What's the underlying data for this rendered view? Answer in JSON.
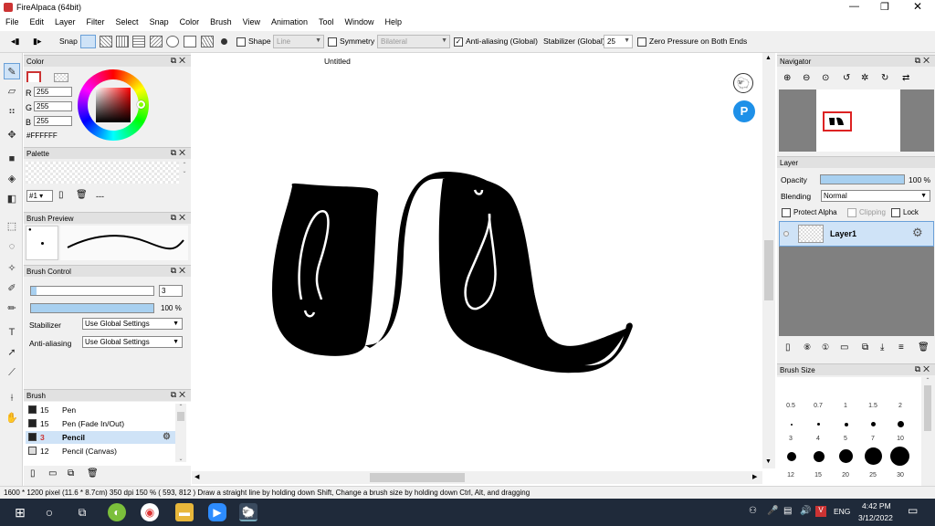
{
  "app": {
    "title": "FireAlpaca (64bit)"
  },
  "menu": [
    "File",
    "Edit",
    "Layer",
    "Filter",
    "Select",
    "Snap",
    "Color",
    "Brush",
    "View",
    "Animation",
    "Tool",
    "Window",
    "Help"
  ],
  "toolbar": {
    "snap_label": "Snap",
    "shape_label": "Shape",
    "shape_value": "Line",
    "symmetry_label": "Symmetry",
    "symmetry_value": "Bilateral",
    "antialias_label": "Anti-aliasing (Global)",
    "stabilizer_label": "Stabilizer (Global)",
    "stabilizer_value": "25",
    "zero_pressure_label": "Zero Pressure on Both Ends"
  },
  "color_panel": {
    "title": "Color",
    "r_label": "R",
    "r_value": "255",
    "g_label": "G",
    "g_value": "255",
    "b_label": "B",
    "b_value": "255",
    "hex": "#FFFFFF"
  },
  "palette_panel": {
    "title": "Palette",
    "selector": "#1",
    "dash": "---"
  },
  "brush_preview": {
    "title": "Brush Preview"
  },
  "brush_control": {
    "title": "Brush Control",
    "size_value": "3",
    "opacity_value": "100 %",
    "stabilizer_label": "Stabilizer",
    "stabilizer_value": "Use Global Settings",
    "antialias_label": "Anti-aliasing",
    "antialias_value": "Use Global Settings"
  },
  "brush_list": {
    "title": "Brush",
    "items": [
      {
        "size": "15",
        "name": "Pen"
      },
      {
        "size": "15",
        "name": "Pen (Fade In/Out)"
      },
      {
        "size": "3",
        "name": "Pencil"
      },
      {
        "size": "12",
        "name": "Pencil (Canvas)"
      }
    ]
  },
  "canvas": {
    "tab_title": "Untitled"
  },
  "navigator": {
    "title": "Navigator"
  },
  "layer_panel": {
    "title": "Layer",
    "opacity_label": "Opacity",
    "opacity_value": "100 %",
    "blending_label": "Blending",
    "blending_value": "Normal",
    "protect_alpha": "Protect Alpha",
    "clipping": "Clipping",
    "lock": "Lock",
    "layer_name": "Layer1"
  },
  "brush_size_panel": {
    "title": "Brush Size",
    "labels_row1": [
      "0.5",
      "0.7",
      "1",
      "1.5",
      "2"
    ],
    "labels_row2": [
      "3",
      "4",
      "5",
      "7",
      "10"
    ],
    "labels_row3": [
      "12",
      "15",
      "20",
      "25",
      "30"
    ]
  },
  "status": {
    "text": "1600 * 1200 pixel  (11.6 * 8.7cm)  350 dpi  150 %  ( 593, 812 )  Draw a straight line by holding down Shift, Change a brush size by holding down Ctrl, Alt, and dragging"
  },
  "taskbar": {
    "lang": "ENG",
    "time": "4:42 PM",
    "date": "3/12/2022"
  }
}
